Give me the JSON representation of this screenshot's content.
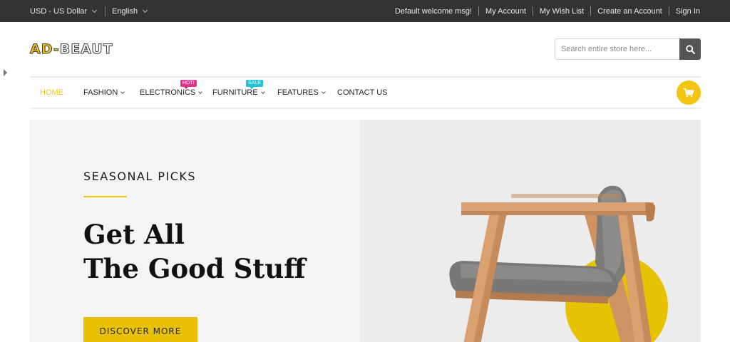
{
  "topbar": {
    "currency": "USD - US Dollar",
    "language": "English",
    "links": {
      "welcome": "Default welcome msg!",
      "my_account": "My Account",
      "wish_list": "My Wish List",
      "create_account": "Create an Account",
      "sign_in": "Sign In"
    }
  },
  "header": {
    "logo_part1": "AD-",
    "logo_part2": "BEAUT",
    "search_placeholder": "Search entire store here...",
    "search_icon": "search-icon",
    "cart_icon": "cart-icon"
  },
  "nav": {
    "items": [
      {
        "label": "HOME",
        "active": true
      },
      {
        "label": "FASHION"
      },
      {
        "label": "ELECTRONICS",
        "badge": "HOT!"
      },
      {
        "label": "FURNITURE",
        "badge": "SALE"
      },
      {
        "label": "FEATURES"
      },
      {
        "label": "CONTACT US"
      }
    ]
  },
  "hero": {
    "kicker": "SEASONAL PICKS",
    "headline_line1": "Get All",
    "headline_line2": "The Good Stuff",
    "cta": "DISCOVER MORE"
  },
  "colors": {
    "accent": "#f2c510",
    "topbar": "#333333",
    "hot_badge": "#e0348a",
    "sale_badge": "#1ec3d8"
  }
}
